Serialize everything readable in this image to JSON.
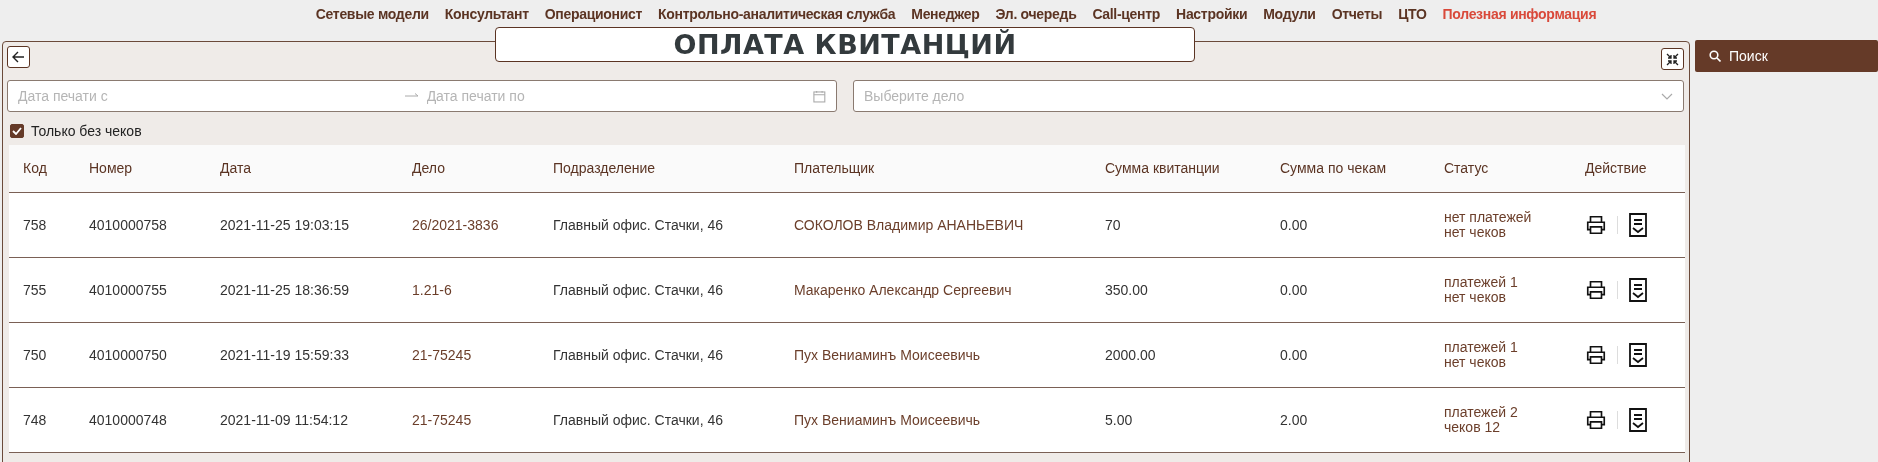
{
  "nav": [
    {
      "label": "Сетевые модели",
      "selected": false
    },
    {
      "label": "Консультант",
      "selected": false
    },
    {
      "label": "Операционист",
      "selected": false
    },
    {
      "label": "Контрольно-аналитическая служба",
      "selected": false
    },
    {
      "label": "Менеджер",
      "selected": false
    },
    {
      "label": "Эл. очередь",
      "selected": false
    },
    {
      "label": "Call-центр",
      "selected": false
    },
    {
      "label": "Настройки",
      "selected": false
    },
    {
      "label": "Модули",
      "selected": false
    },
    {
      "label": "Отчеты",
      "selected": false
    },
    {
      "label": "ЦТО",
      "selected": false
    },
    {
      "label": "Полезная информация",
      "selected": true
    }
  ],
  "page_title": "ОПЛАТА КВИТАНЦИЙ",
  "filters": {
    "date_from": {
      "placeholder": "Дата печати с"
    },
    "date_to": {
      "placeholder": "Дата печати по"
    },
    "case_select": {
      "placeholder": "Выберите дело"
    },
    "only_without_checks": {
      "label": "Только без чеков",
      "checked": true
    }
  },
  "search_button": "Поиск",
  "table": {
    "columns": [
      {
        "label": "Код",
        "kind": "text"
      },
      {
        "label": "Номер",
        "kind": "text"
      },
      {
        "label": "Дата",
        "kind": "text"
      },
      {
        "label": "Дело",
        "kind": "link"
      },
      {
        "label": "Подразделение",
        "kind": "text"
      },
      {
        "label": "Плательщик",
        "kind": "link"
      },
      {
        "label": "Сумма квитанции",
        "kind": "text"
      },
      {
        "label": "Сумма по чекам",
        "kind": "text"
      },
      {
        "label": "Статус",
        "kind": "status"
      },
      {
        "label": "Действие",
        "kind": "actions"
      }
    ],
    "rows": [
      {
        "cells": [
          "758",
          "4010000758",
          "2021-11-25 19:03:15",
          "26/2021-3836",
          "Главный офис. Стачки, 46",
          "СОКОЛОВ Владимир АНАНЬЕВИЧ",
          "70",
          "0.00",
          "нет платежей\nнет чеков"
        ]
      },
      {
        "cells": [
          "755",
          "4010000755",
          "2021-11-25 18:36:59",
          "1.21-6",
          "Главный офис. Стачки, 46",
          "Макаренко Александр Сергеевич",
          "350.00",
          "0.00",
          "платежей 1\nнет чеков"
        ]
      },
      {
        "cells": [
          "750",
          "4010000750",
          "2021-11-19 15:59:33",
          "21-75245",
          "Главный офис. Стачки, 46",
          "Пух Вениаминъ Моисеевичь",
          "2000.00",
          "0.00",
          "платежей 1\nнет чеков"
        ]
      },
      {
        "cells": [
          "748",
          "4010000748",
          "2021-11-09 11:54:12",
          "21-75245",
          "Главный офис. Стачки, 46",
          "Пух Вениаминъ Моисеевичь",
          "5.00",
          "2.00",
          "платежей 2\nчеков 12"
        ]
      }
    ]
  }
}
